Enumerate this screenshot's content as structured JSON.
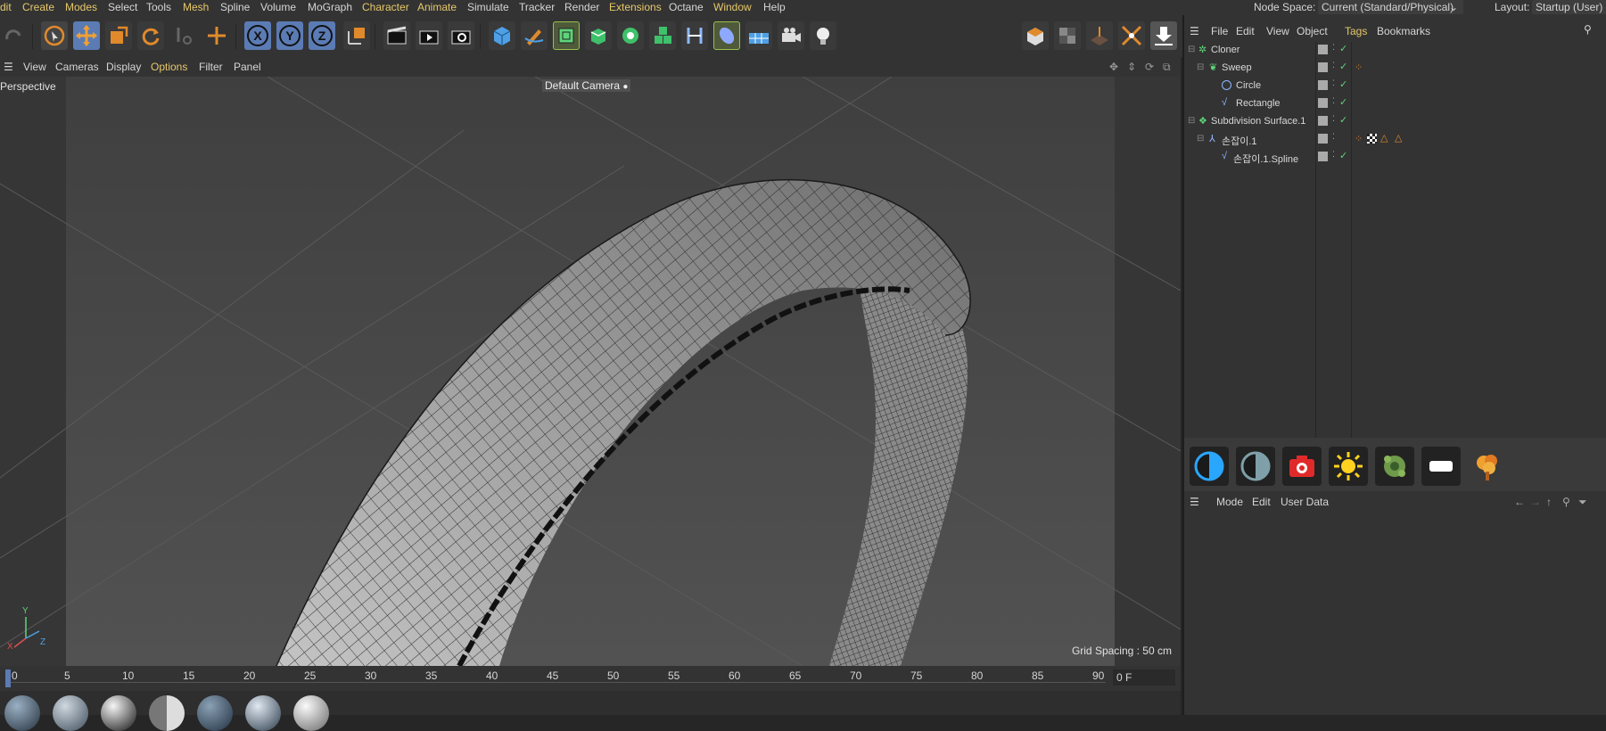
{
  "menubar": {
    "items": [
      {
        "label": "dit",
        "color": "yellow"
      },
      {
        "label": "Create",
        "color": "yellow"
      },
      {
        "label": "Modes",
        "color": "yellow"
      },
      {
        "label": "Select",
        "color": "white"
      },
      {
        "label": "Tools",
        "color": "white"
      },
      {
        "label": "Mesh",
        "color": "yellow"
      },
      {
        "label": "Spline",
        "color": "white"
      },
      {
        "label": "Volume",
        "color": "white"
      },
      {
        "label": "MoGraph",
        "color": "white"
      },
      {
        "label": "Character",
        "color": "yellow"
      },
      {
        "label": "Animate",
        "color": "yellow"
      },
      {
        "label": "Simulate",
        "color": "white"
      },
      {
        "label": "Tracker",
        "color": "white"
      },
      {
        "label": "Render",
        "color": "white"
      },
      {
        "label": "Extensions",
        "color": "yellow"
      },
      {
        "label": "Octane",
        "color": "white"
      },
      {
        "label": "Window",
        "color": "yellow"
      },
      {
        "label": "Help",
        "color": "white"
      }
    ],
    "node_space_label": "Node Space:",
    "node_space_value": "Current (Standard/Physical)",
    "layout_label": "Layout:",
    "layout_value": "Startup (User)"
  },
  "viewport": {
    "menu": [
      "View",
      "Cameras",
      "Display",
      "Options",
      "Filter",
      "Panel"
    ],
    "label": "Perspective",
    "camera": "Default Camera",
    "grid_spacing": "Grid Spacing : 50 cm",
    "axis_x": "X",
    "axis_y": "Y",
    "axis_z": "Z"
  },
  "timeline": {
    "ticks": [
      "0",
      "5",
      "10",
      "15",
      "20",
      "25",
      "30",
      "35",
      "40",
      "45",
      "50",
      "55",
      "60",
      "65",
      "70",
      "75",
      "80",
      "85",
      "90"
    ],
    "frame": "0 F"
  },
  "object_manager": {
    "menu": [
      {
        "label": "File",
        "color": "white"
      },
      {
        "label": "Edit",
        "color": "white"
      },
      {
        "label": "View",
        "color": "white"
      },
      {
        "label": "Object",
        "color": "white"
      },
      {
        "label": "Tags",
        "color": "yellow"
      },
      {
        "label": "Bookmarks",
        "color": "white"
      }
    ],
    "rows": [
      {
        "name": "Cloner",
        "icon": "cloner-icon"
      },
      {
        "name": "Sweep",
        "icon": "sweep-icon"
      },
      {
        "name": "Circle",
        "icon": "circle-spline-icon"
      },
      {
        "name": "Rectangle",
        "icon": "spline-icon"
      },
      {
        "name": "Subdivision Surface.1",
        "icon": "subdivision-icon"
      },
      {
        "name": "손잡이.1",
        "icon": "null-object-icon"
      },
      {
        "name": "손잡이.1.Spline",
        "icon": "spline-icon"
      }
    ]
  },
  "attributes": {
    "menu": [
      "Mode",
      "Edit",
      "User Data"
    ]
  },
  "colors": {
    "accent_blue": "#5b7bb4",
    "menu_yellow": "#e6c86a",
    "check_green": "#5fd47a",
    "tag_orange": "#e08a2c"
  }
}
